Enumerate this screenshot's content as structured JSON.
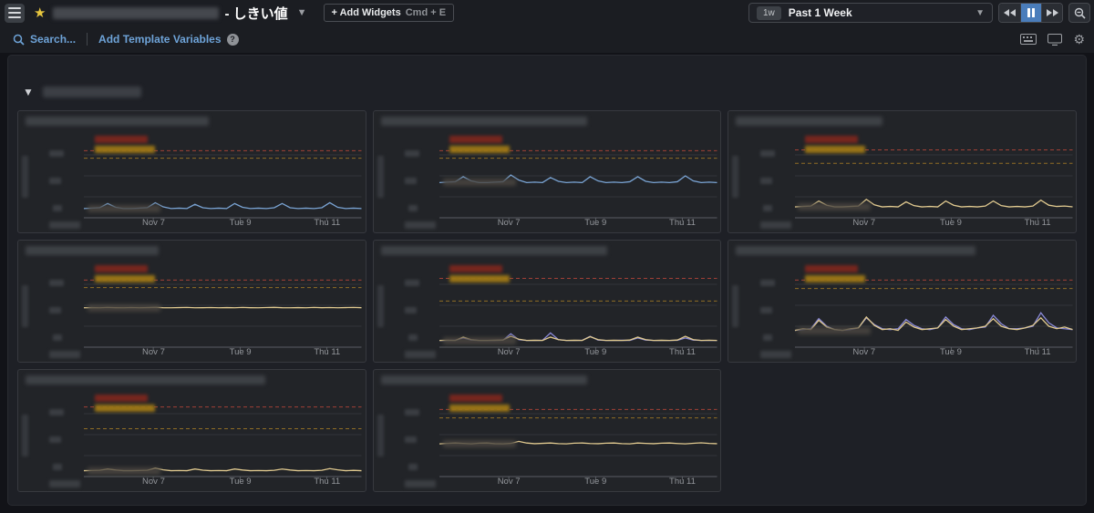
{
  "header": {
    "title_redacted": true,
    "dashboard_title_suffix": "- しきい値",
    "add_widgets_label": "+ Add Widgets",
    "add_widgets_shortcut": "Cmd + E",
    "time_range_badge": "1w",
    "time_range_label": "Past 1 Week"
  },
  "toolbar": {
    "search_label": "Search...",
    "template_vars_label": "Add Template Variables",
    "help_glyph": "?"
  },
  "section": {
    "title_redacted": true
  },
  "colors": {
    "accent_blue": "#4a7dbb",
    "link_blue": "#6ea3d8",
    "star_yellow": "#e7c63f",
    "series_blue": "#7aa4d4",
    "series_yellow": "#e0c98f",
    "series_purple": "#8a8ad8",
    "threshold_critical": "#a04036",
    "threshold_warning": "#8f6d25"
  },
  "chart_data": [
    {
      "type": "line",
      "title_redacted": true,
      "title_blur_pct": 55,
      "x_ticks": [
        "Nov 7",
        "Tue 9",
        "Thu 11"
      ],
      "ylim": [
        0,
        100
      ],
      "thresholds": {
        "critical": 80,
        "warning": 71
      },
      "legend_redacted_entries": 2,
      "series": [
        {
          "name": "redacted-series-1",
          "color": "#7aa4d4",
          "values": [
            11,
            11.5,
            12,
            17,
            12.5,
            11,
            11,
            11.5,
            12,
            18,
            13,
            11,
            11.5,
            11,
            16,
            12,
            11,
            11.5,
            11,
            17,
            12.5,
            11,
            11.5,
            11,
            12,
            17,
            12,
            11,
            11.5,
            11,
            12,
            18,
            12.5,
            11,
            11.5,
            11
          ]
        }
      ]
    },
    {
      "type": "line",
      "title_redacted": true,
      "title_blur_pct": 62,
      "x_ticks": [
        "Nov 7",
        "Tue 9",
        "Thu 11"
      ],
      "ylim": [
        0,
        100
      ],
      "thresholds": {
        "critical": 80,
        "warning": 71
      },
      "legend_redacted_entries": 2,
      "series": [
        {
          "name": "redacted-series-1",
          "color": "#7aa4d4",
          "values": [
            42,
            42.5,
            43,
            49,
            44,
            42,
            42,
            42.5,
            43,
            51,
            45,
            42,
            42.5,
            42,
            48,
            43.5,
            42,
            42.5,
            42,
            49,
            44,
            42,
            42.5,
            42,
            43,
            49,
            43.5,
            42,
            42.5,
            42,
            43,
            50,
            44,
            42,
            42.5,
            42
          ]
        }
      ]
    },
    {
      "type": "line",
      "title_redacted": true,
      "title_blur_pct": 44,
      "x_ticks": [
        "Nov 7",
        "Tue 9",
        "Thu 11"
      ],
      "ylim": [
        0,
        100
      ],
      "thresholds": {
        "critical": 81,
        "warning": 65
      },
      "legend_redacted_entries": 2,
      "series": [
        {
          "name": "redacted-series-1",
          "color": "#e0c98f",
          "values": [
            13,
            13.5,
            14,
            20,
            15,
            13,
            13,
            13.5,
            14,
            22,
            15.5,
            13,
            13.5,
            13,
            19,
            14.5,
            13,
            13.5,
            13,
            20,
            15,
            13,
            13.5,
            13,
            14,
            20,
            14.5,
            13,
            13.5,
            13,
            14,
            21,
            15,
            13.5,
            14,
            13
          ]
        }
      ]
    },
    {
      "type": "line",
      "title_redacted": true,
      "title_blur_pct": 40,
      "x_ticks": [
        "Nov 7",
        "Tue 9",
        "Thu 11"
      ],
      "ylim": [
        0,
        100
      ],
      "thresholds": {
        "critical": 80,
        "warning": 71
      },
      "legend_redacted_entries": 2,
      "series": [
        {
          "name": "redacted-series-1",
          "color": "#e0c98f",
          "values": [
            47,
            47.2,
            47,
            47.4,
            47.1,
            47,
            47.3,
            47,
            47.2,
            47.5,
            47.1,
            47,
            47.2,
            47.4,
            47,
            47.1,
            47.3,
            47,
            47.2,
            47,
            47.4,
            47.1,
            47,
            47.3,
            47.5,
            47.1,
            47,
            47.2,
            47,
            47.4,
            47.1,
            47.3,
            47,
            47.2,
            47.4,
            47.1
          ]
        }
      ]
    },
    {
      "type": "line",
      "title_redacted": true,
      "title_blur_pct": 68,
      "x_ticks": [
        "Nov 7",
        "Tue 9",
        "Thu 11"
      ],
      "ylim": [
        0,
        100
      ],
      "thresholds": {
        "critical": 82,
        "warning": 55
      },
      "legend_redacted_entries": 2,
      "series": [
        {
          "name": "redacted-series-1",
          "color": "#8a8ad8",
          "values": [
            8,
            8,
            8.2,
            11,
            8.5,
            8,
            8,
            8,
            8.3,
            16,
            9,
            8,
            8,
            8.2,
            17,
            9,
            8,
            8,
            8.2,
            13,
            8.5,
            8,
            8,
            8.2,
            8,
            11,
            8.5,
            8,
            8,
            8,
            8.2,
            11,
            8.5,
            8,
            8,
            8
          ]
        },
        {
          "name": "redacted-series-2",
          "color": "#e0c98f",
          "values": [
            8,
            8.3,
            8,
            12,
            9,
            8,
            8,
            8.2,
            8.5,
            13,
            9.5,
            8,
            8.2,
            8,
            12,
            9,
            8,
            8.2,
            8,
            12.5,
            9,
            8,
            8.2,
            8,
            8.5,
            12,
            9,
            8,
            8.2,
            8,
            8.5,
            13,
            9,
            8,
            8.3,
            8
          ]
        }
      ]
    },
    {
      "type": "line",
      "title_redacted": true,
      "title_blur_pct": 72,
      "x_ticks": [
        "Nov 7",
        "Tue 9",
        "Thu 11"
      ],
      "ylim": [
        0,
        100
      ],
      "thresholds": {
        "critical": 80,
        "warning": 70
      },
      "legend_redacted_entries": 2,
      "series": [
        {
          "name": "redacted-series-1",
          "color": "#8a8ad8",
          "values": [
            20,
            21,
            22,
            34,
            25,
            21,
            20,
            21,
            23,
            35,
            27,
            22,
            21,
            22,
            33,
            26,
            22,
            21,
            23,
            36,
            27,
            22,
            21,
            23,
            24,
            38,
            28,
            22,
            22,
            23,
            25,
            41,
            29,
            23,
            22,
            21
          ]
        },
        {
          "name": "redacted-series-2",
          "color": "#e0c98f",
          "values": [
            20,
            22,
            21,
            32,
            24,
            21,
            20,
            22,
            23,
            36,
            26,
            21,
            22,
            20,
            30,
            24,
            21,
            22,
            23,
            33,
            25,
            21,
            22,
            23,
            25,
            34,
            25,
            22,
            21,
            23,
            26,
            35,
            25,
            22,
            24,
            21
          ]
        }
      ]
    },
    {
      "type": "line",
      "title_redacted": true,
      "title_blur_pct": 72,
      "x_ticks": [
        "Nov 7",
        "Tue 9",
        "Thu 11"
      ],
      "ylim": [
        0,
        100
      ],
      "thresholds": {
        "critical": 83,
        "warning": 57
      },
      "legend_redacted_entries": 2,
      "series": [
        {
          "name": "redacted-series-1",
          "color": "#e0c98f",
          "values": [
            7,
            7.2,
            7.5,
            9,
            7.8,
            7,
            7,
            7.2,
            7.5,
            10,
            8,
            7,
            7.2,
            7,
            9,
            7.6,
            7,
            7.2,
            7,
            9,
            7.8,
            7,
            7.2,
            7,
            7.5,
            9,
            7.8,
            7,
            7.2,
            7,
            7.5,
            9.5,
            8,
            7,
            7.4,
            7
          ]
        }
      ]
    },
    {
      "type": "line",
      "title_redacted": true,
      "title_blur_pct": 62,
      "x_ticks": [
        "Nov 7",
        "Tue 9",
        "Thu 11"
      ],
      "ylim": [
        0,
        100
      ],
      "thresholds": {
        "critical": 80,
        "warning": 70
      },
      "legend_redacted_entries": 2,
      "series": [
        {
          "name": "redacted-series-1",
          "color": "#e0c98f",
          "values": [
            39,
            39.5,
            40,
            39.5,
            39,
            39.8,
            40,
            39.2,
            39,
            39.6,
            42,
            40,
            39.2,
            39.6,
            40,
            39.3,
            39,
            39.8,
            40,
            39.4,
            39.2,
            39.8,
            40,
            39.3,
            39,
            40,
            39.5,
            39.2,
            39.8,
            40,
            39.4,
            39,
            39.7,
            40.2,
            39.5,
            39.2
          ]
        }
      ]
    }
  ]
}
